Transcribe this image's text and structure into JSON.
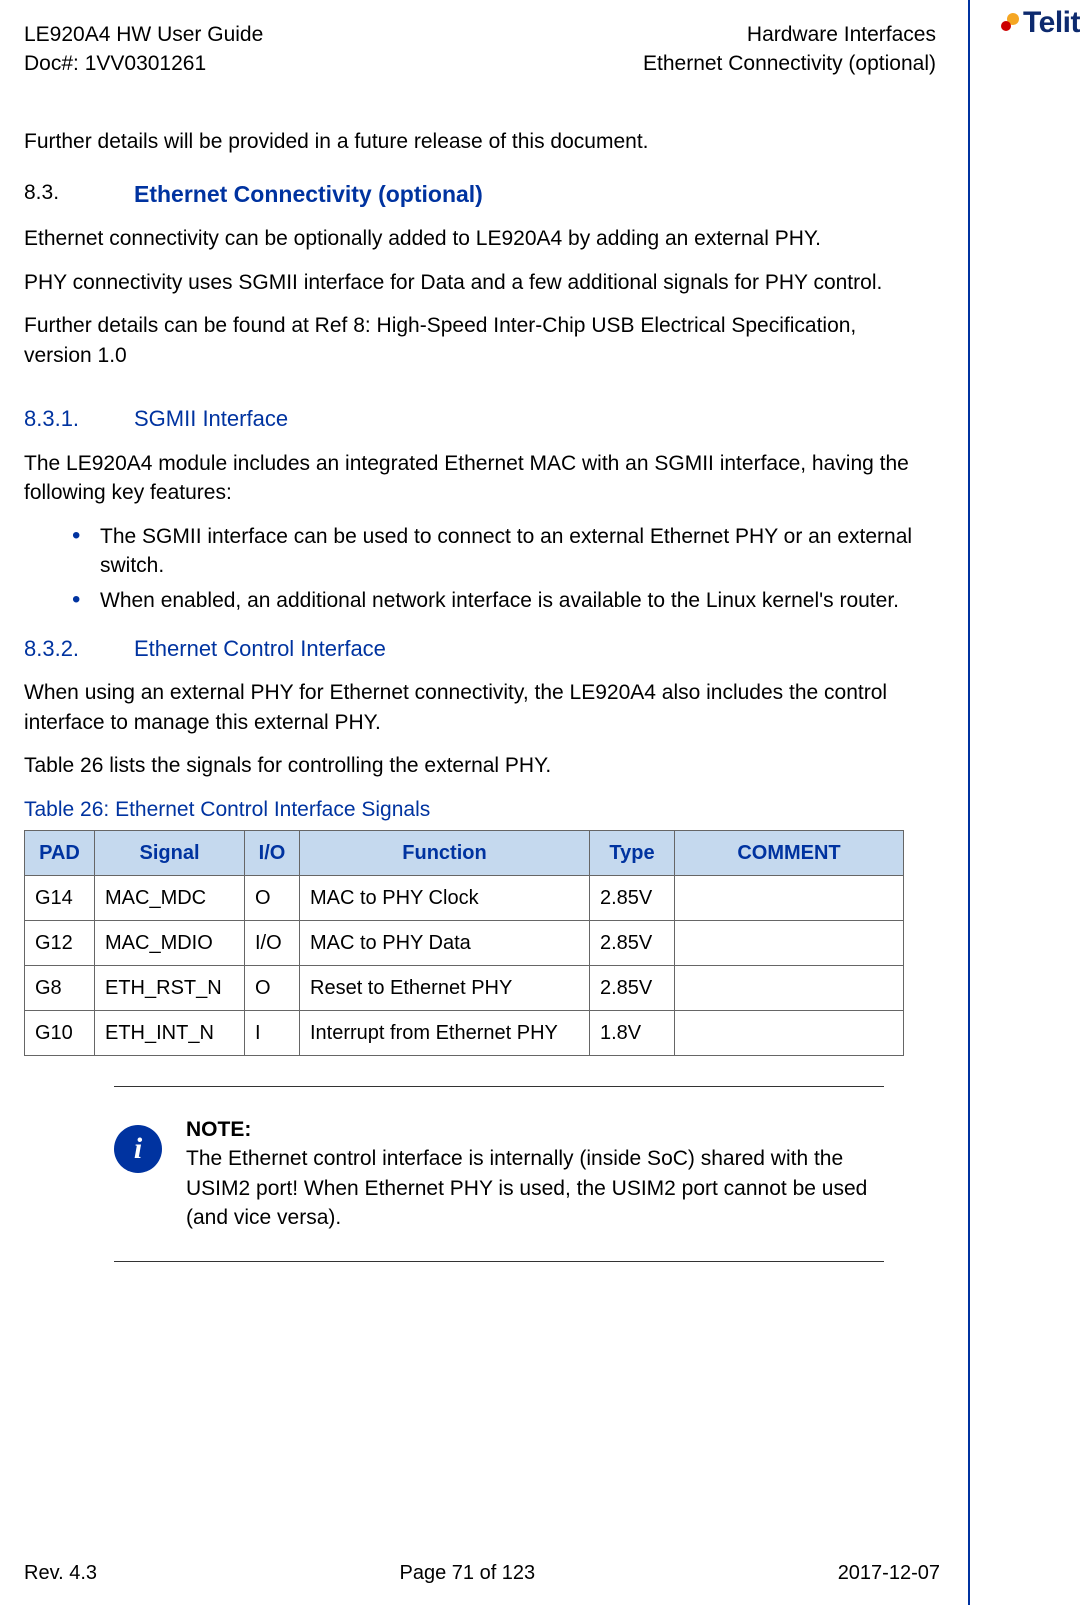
{
  "header": {
    "doc_title": "LE920A4 HW User Guide",
    "doc_number": "Doc#: 1VV0301261",
    "section": "Hardware Interfaces",
    "subsection": "Ethernet Connectivity (optional)",
    "brand": "Telit"
  },
  "body": {
    "intro_future": "Further details will be provided in a future release of this document.",
    "h2_num": "8.3.",
    "h2_title": "Ethernet Connectivity (optional)",
    "p_eth_1": "Ethernet connectivity can be optionally added to LE920A4 by adding an external PHY.",
    "p_eth_2": "PHY connectivity uses SGMII interface for Data and a few additional signals for PHY control.",
    "p_eth_3": "Further details can be found at Ref 8: High-Speed Inter-Chip USB Electrical Specification, version 1.0",
    "h3a_num": "8.3.1.",
    "h3a_title": "SGMII Interface",
    "p_sgmii_intro": "The LE920A4 module includes an integrated Ethernet MAC with an SGMII interface, having the following key features:",
    "bullets": [
      "The SGMII interface can be used to connect to an external Ethernet PHY or an external switch.",
      "When enabled, an additional network interface is available to the Linux kernel's router."
    ],
    "h3b_num": "8.3.2.",
    "h3b_title": "Ethernet Control Interface",
    "p_ctrl_1": "When using an external PHY for Ethernet connectivity, the LE920A4 also includes the control interface to manage this external PHY.",
    "p_ctrl_2": "Table 26 lists the signals for controlling the external PHY.",
    "table_caption": "Table 26: Ethernet Control Interface Signals",
    "table": {
      "headers": [
        "PAD",
        "Signal",
        "I/O",
        "Function",
        "Type",
        "COMMENT"
      ],
      "rows": [
        [
          "G14",
          "MAC_MDC",
          "O",
          "MAC to PHY Clock",
          "2.85V",
          ""
        ],
        [
          "G12",
          "MAC_MDIO",
          "I/O",
          "MAC to PHY Data",
          "2.85V",
          ""
        ],
        [
          "G8",
          "ETH_RST_N",
          "O",
          "Reset to Ethernet PHY",
          "2.85V",
          ""
        ],
        [
          "G10",
          "ETH_INT_N",
          "I",
          "Interrupt from Ethernet PHY",
          "1.8V",
          ""
        ]
      ]
    },
    "note_label": "NOTE:",
    "note_text": "The Ethernet control interface is internally (inside SoC) shared with the USIM2 port! When Ethernet PHY is used, the USIM2 port cannot be used (and vice versa).",
    "note_icon_glyph": "i"
  },
  "footer": {
    "rev": "Rev. 4.3",
    "page": "Page 71 of 123",
    "date": "2017-12-07"
  }
}
